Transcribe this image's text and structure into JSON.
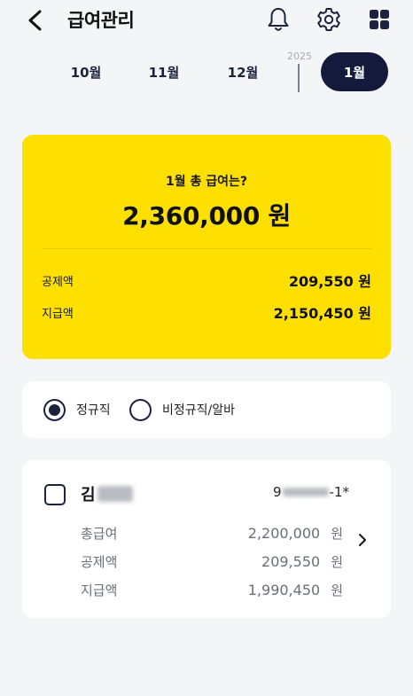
{
  "header": {
    "title": "급여관리",
    "icons": [
      "chevron-left-icon",
      "bell-icon",
      "gear-icon",
      "grid-icon"
    ]
  },
  "months": {
    "year_label": "2025",
    "tabs": [
      {
        "label": "10월",
        "active": false
      },
      {
        "label": "11월",
        "active": false
      },
      {
        "label": "12월",
        "active": false
      },
      {
        "label": "1월",
        "active": true
      }
    ]
  },
  "summary": {
    "label": "1월 총 급여는?",
    "total": "2,360,000 원",
    "deduction_label": "공제액",
    "deduction_value": "209,550 원",
    "payment_label": "지급액",
    "payment_value": "2,150,450 원"
  },
  "employment_type": {
    "options": [
      {
        "label": "정규직",
        "selected": true
      },
      {
        "label": "비정규직/알바",
        "selected": false
      }
    ]
  },
  "employee": {
    "name_visible": "김",
    "id_prefix": "9",
    "id_suffix": "-1*",
    "rows": [
      {
        "label": "총급여",
        "value": "2,200,000",
        "unit": "원"
      },
      {
        "label": "공제액",
        "value": "209,550",
        "unit": "원"
      },
      {
        "label": "지급액",
        "value": "1,990,450",
        "unit": "원"
      }
    ]
  },
  "colors": {
    "accent_yellow": "#fde000",
    "navy": "#141a3c",
    "background": "#f4f5f7"
  }
}
